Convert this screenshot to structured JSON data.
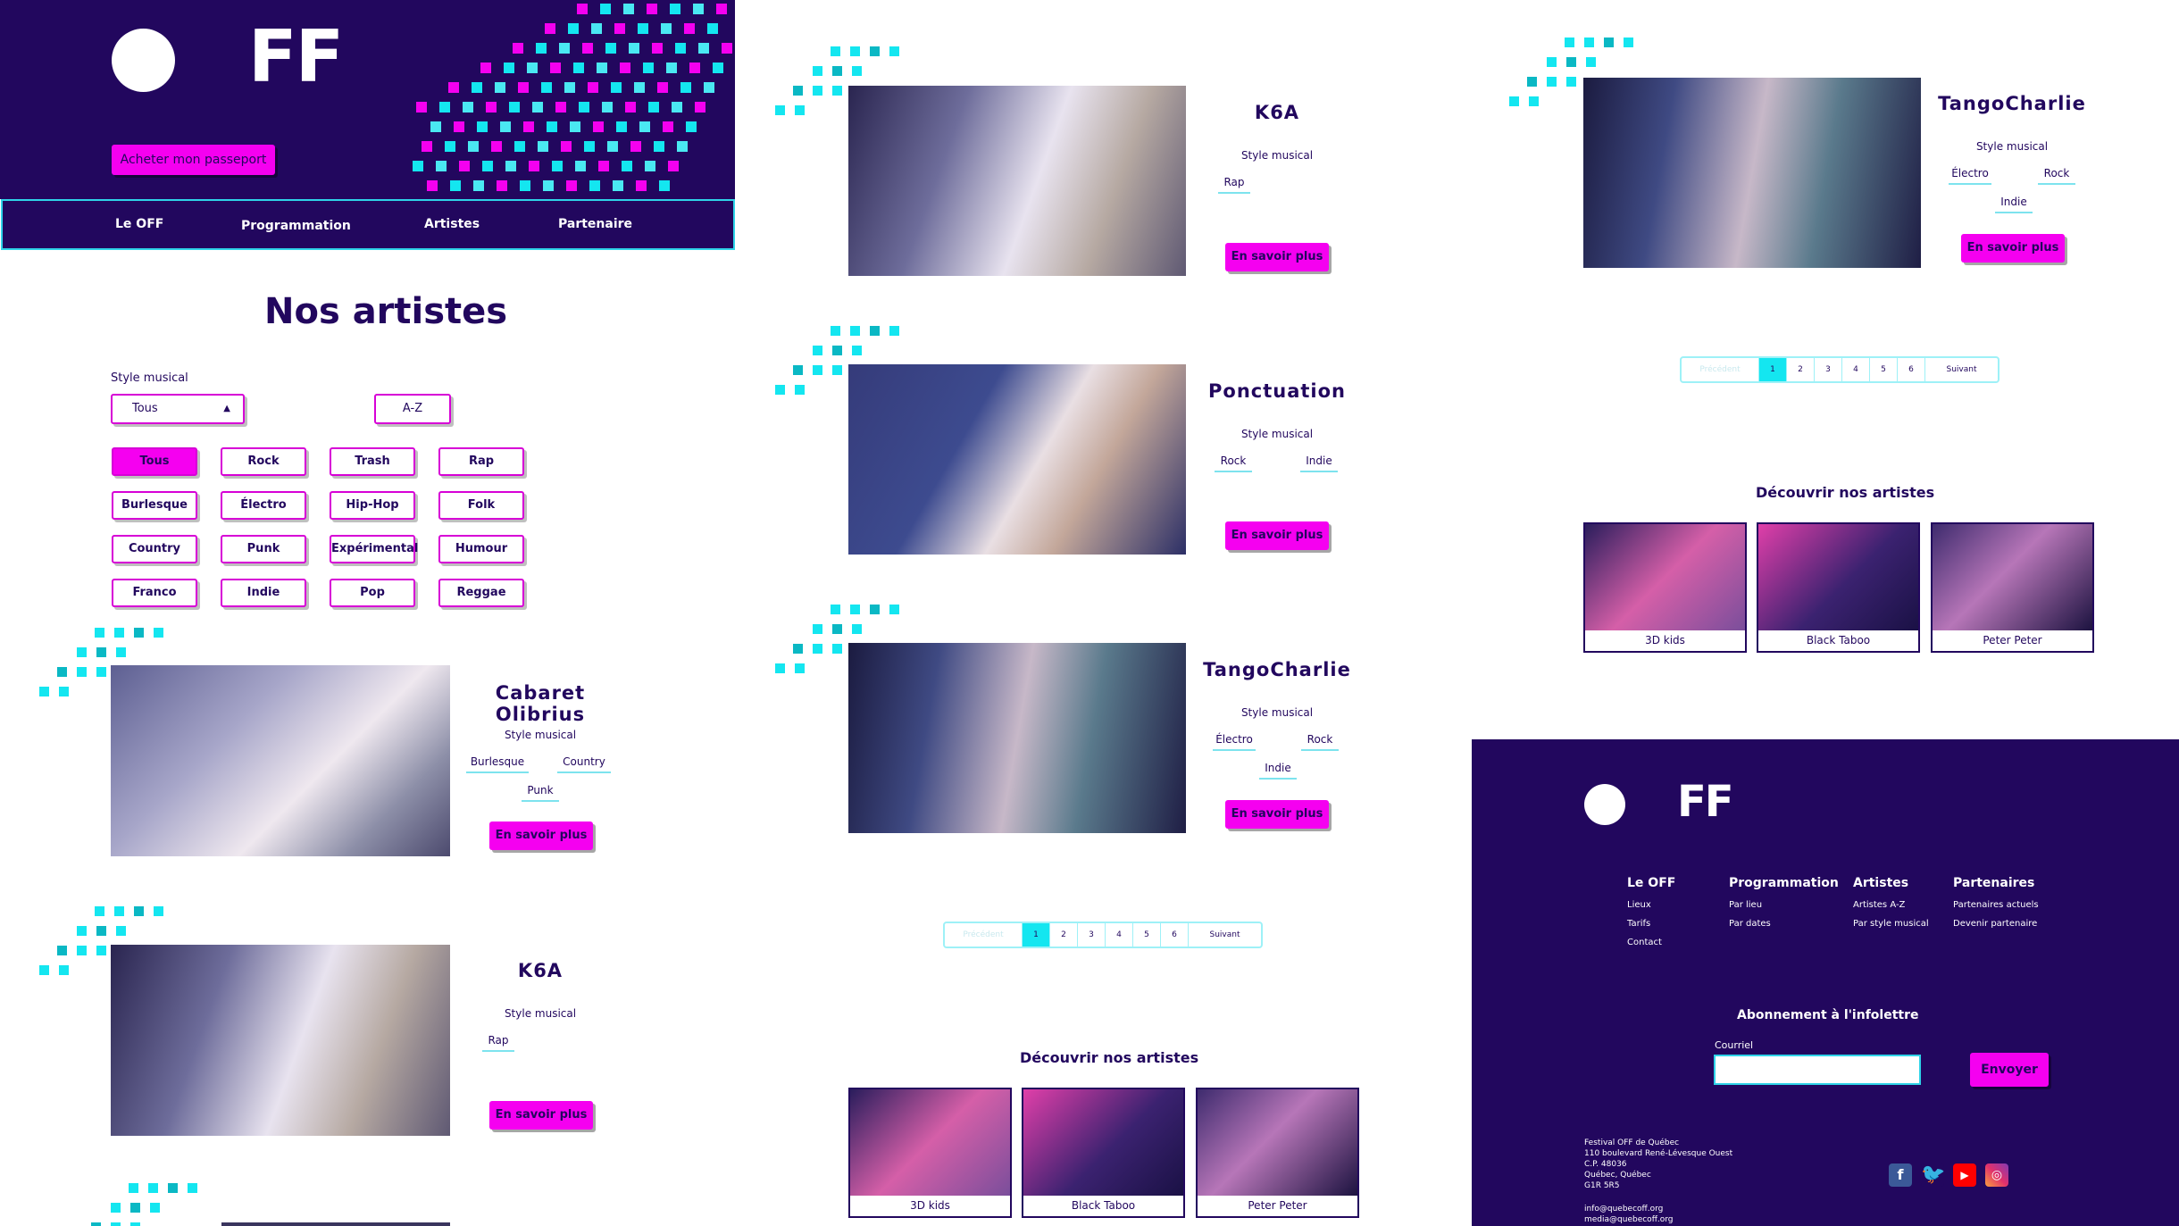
{
  "colors": {
    "navy": "#22075e",
    "magenta": "#f500f0",
    "cyan": "#14e6f0",
    "white": "#ffffff"
  },
  "header": {
    "logo_text": "FF",
    "cta_label": "Acheter mon passeport",
    "nav": [
      "Le OFF",
      "Programmation",
      "Artistes",
      "Partenaire"
    ]
  },
  "listing": {
    "title": "Nos artistes",
    "filter_label": "Style musical",
    "select_value": "Tous",
    "sort_label": "A-Z",
    "chips": [
      "Tous",
      "Rock",
      "Trash",
      "Rap",
      "Burlesque",
      "Électro",
      "Hip-Hop",
      "Folk",
      "Country",
      "Punk",
      "Expérimental",
      "Humour",
      "Franco",
      "Indie",
      "Pop",
      "Reggae"
    ],
    "active_chip": "Tous"
  },
  "artists": {
    "style_label": "Style musical",
    "more_label": "En savoir plus",
    "cabaret": {
      "name": "Cabaret Olibrius",
      "tags": [
        "Burlesque",
        "Country",
        "Punk"
      ]
    },
    "k6a": {
      "name": "K6A",
      "tags": [
        "Rap"
      ]
    },
    "ponctuation": {
      "name": "Ponctuation",
      "tags": [
        "Rock",
        "Indie"
      ]
    },
    "tango": {
      "name": "TangoCharlie",
      "tags": [
        "Électro",
        "Rock",
        "Indie"
      ]
    }
  },
  "pagination": {
    "prev": "Précédent",
    "pages": [
      "1",
      "2",
      "3",
      "4",
      "5",
      "6"
    ],
    "current": "1",
    "next": "Suivant"
  },
  "discover": {
    "title": "Découvrir nos artistes",
    "items": [
      "3D kids",
      "Black Taboo",
      "Peter Peter"
    ]
  },
  "footer": {
    "columns": [
      {
        "title": "Le OFF",
        "links": [
          "Lieux",
          "Tarifs",
          "Contact"
        ]
      },
      {
        "title": "Programmation",
        "links": [
          "Par lieu",
          "Par dates"
        ]
      },
      {
        "title": "Artistes",
        "links": [
          "Artistes A-Z",
          "Par style musical"
        ]
      },
      {
        "title": "Partenaires",
        "links": [
          "Partenaires actuels",
          "Devenir partenaire"
        ]
      }
    ],
    "newsletter_title": "Abonnement à l'infolettre",
    "email_label": "Courriel",
    "submit_label": "Envoyer",
    "address": "Festival OFF de Québec\n110 boulevard René-Lévesque Ouest\nC.P. 48036\nQuébec, Québec\nG1R 5R5",
    "contacts": "info@quebecoff.org\nmedia@quebecoff.org",
    "social": [
      "facebook-icon",
      "twitter-icon",
      "youtube-icon",
      "instagram-icon"
    ]
  }
}
